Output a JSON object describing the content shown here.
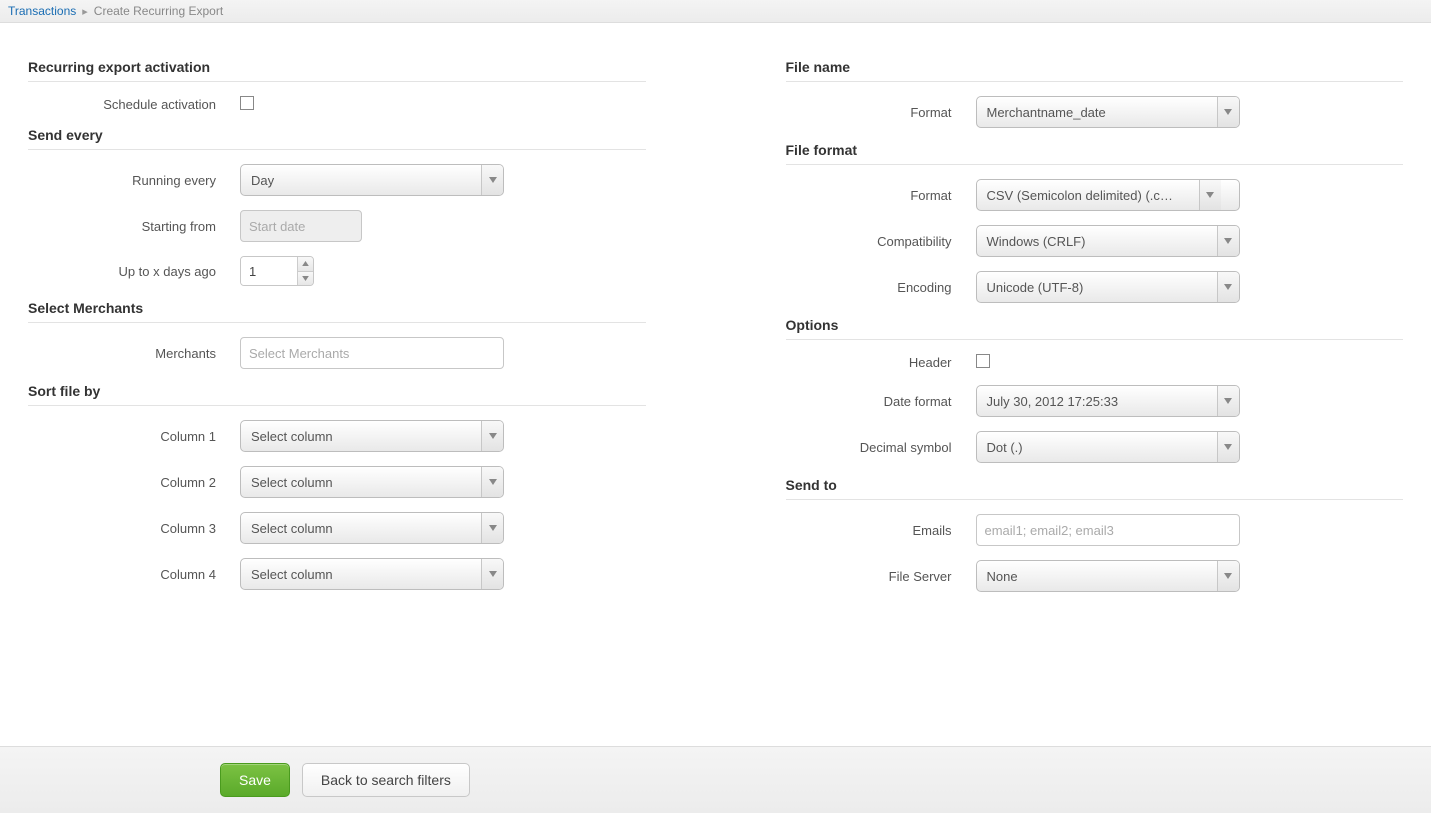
{
  "breadcrumb": {
    "parent": "Transactions",
    "current": "Create Recurring Export"
  },
  "sections": {
    "activation": {
      "title": "Recurring export activation",
      "schedule_label": "Schedule activation"
    },
    "send_every": {
      "title": "Send every",
      "running_every_label": "Running every",
      "running_every_value": "Day",
      "starting_from_label": "Starting from",
      "starting_from_placeholder": "Start date",
      "up_to_label": "Up to x days ago",
      "up_to_value": "1"
    },
    "merchants": {
      "title": "Select Merchants",
      "label": "Merchants",
      "placeholder": "Select Merchants"
    },
    "sort": {
      "title": "Sort file by",
      "columns": [
        {
          "label": "Column 1",
          "value": "Select column"
        },
        {
          "label": "Column 2",
          "value": "Select column"
        },
        {
          "label": "Column 3",
          "value": "Select column"
        },
        {
          "label": "Column 4",
          "value": "Select column"
        }
      ]
    },
    "filename": {
      "title": "File name",
      "format_label": "Format",
      "format_value": "Merchantname_date"
    },
    "fileformat": {
      "title": "File format",
      "format_label": "Format",
      "format_value": "CSV (Semicolon delimited) (.c…",
      "compat_label": "Compatibility",
      "compat_value": "Windows (CRLF)",
      "encoding_label": "Encoding",
      "encoding_value": "Unicode (UTF-8)"
    },
    "options": {
      "title": "Options",
      "header_label": "Header",
      "date_format_label": "Date format",
      "date_format_value": "July 30, 2012 17:25:33",
      "decimal_label": "Decimal symbol",
      "decimal_value": "Dot (.)"
    },
    "sendto": {
      "title": "Send to",
      "emails_label": "Emails",
      "emails_placeholder": "email1; email2; email3",
      "fileserver_label": "File Server",
      "fileserver_value": "None"
    }
  },
  "footer": {
    "save": "Save",
    "back": "Back to search filters"
  }
}
